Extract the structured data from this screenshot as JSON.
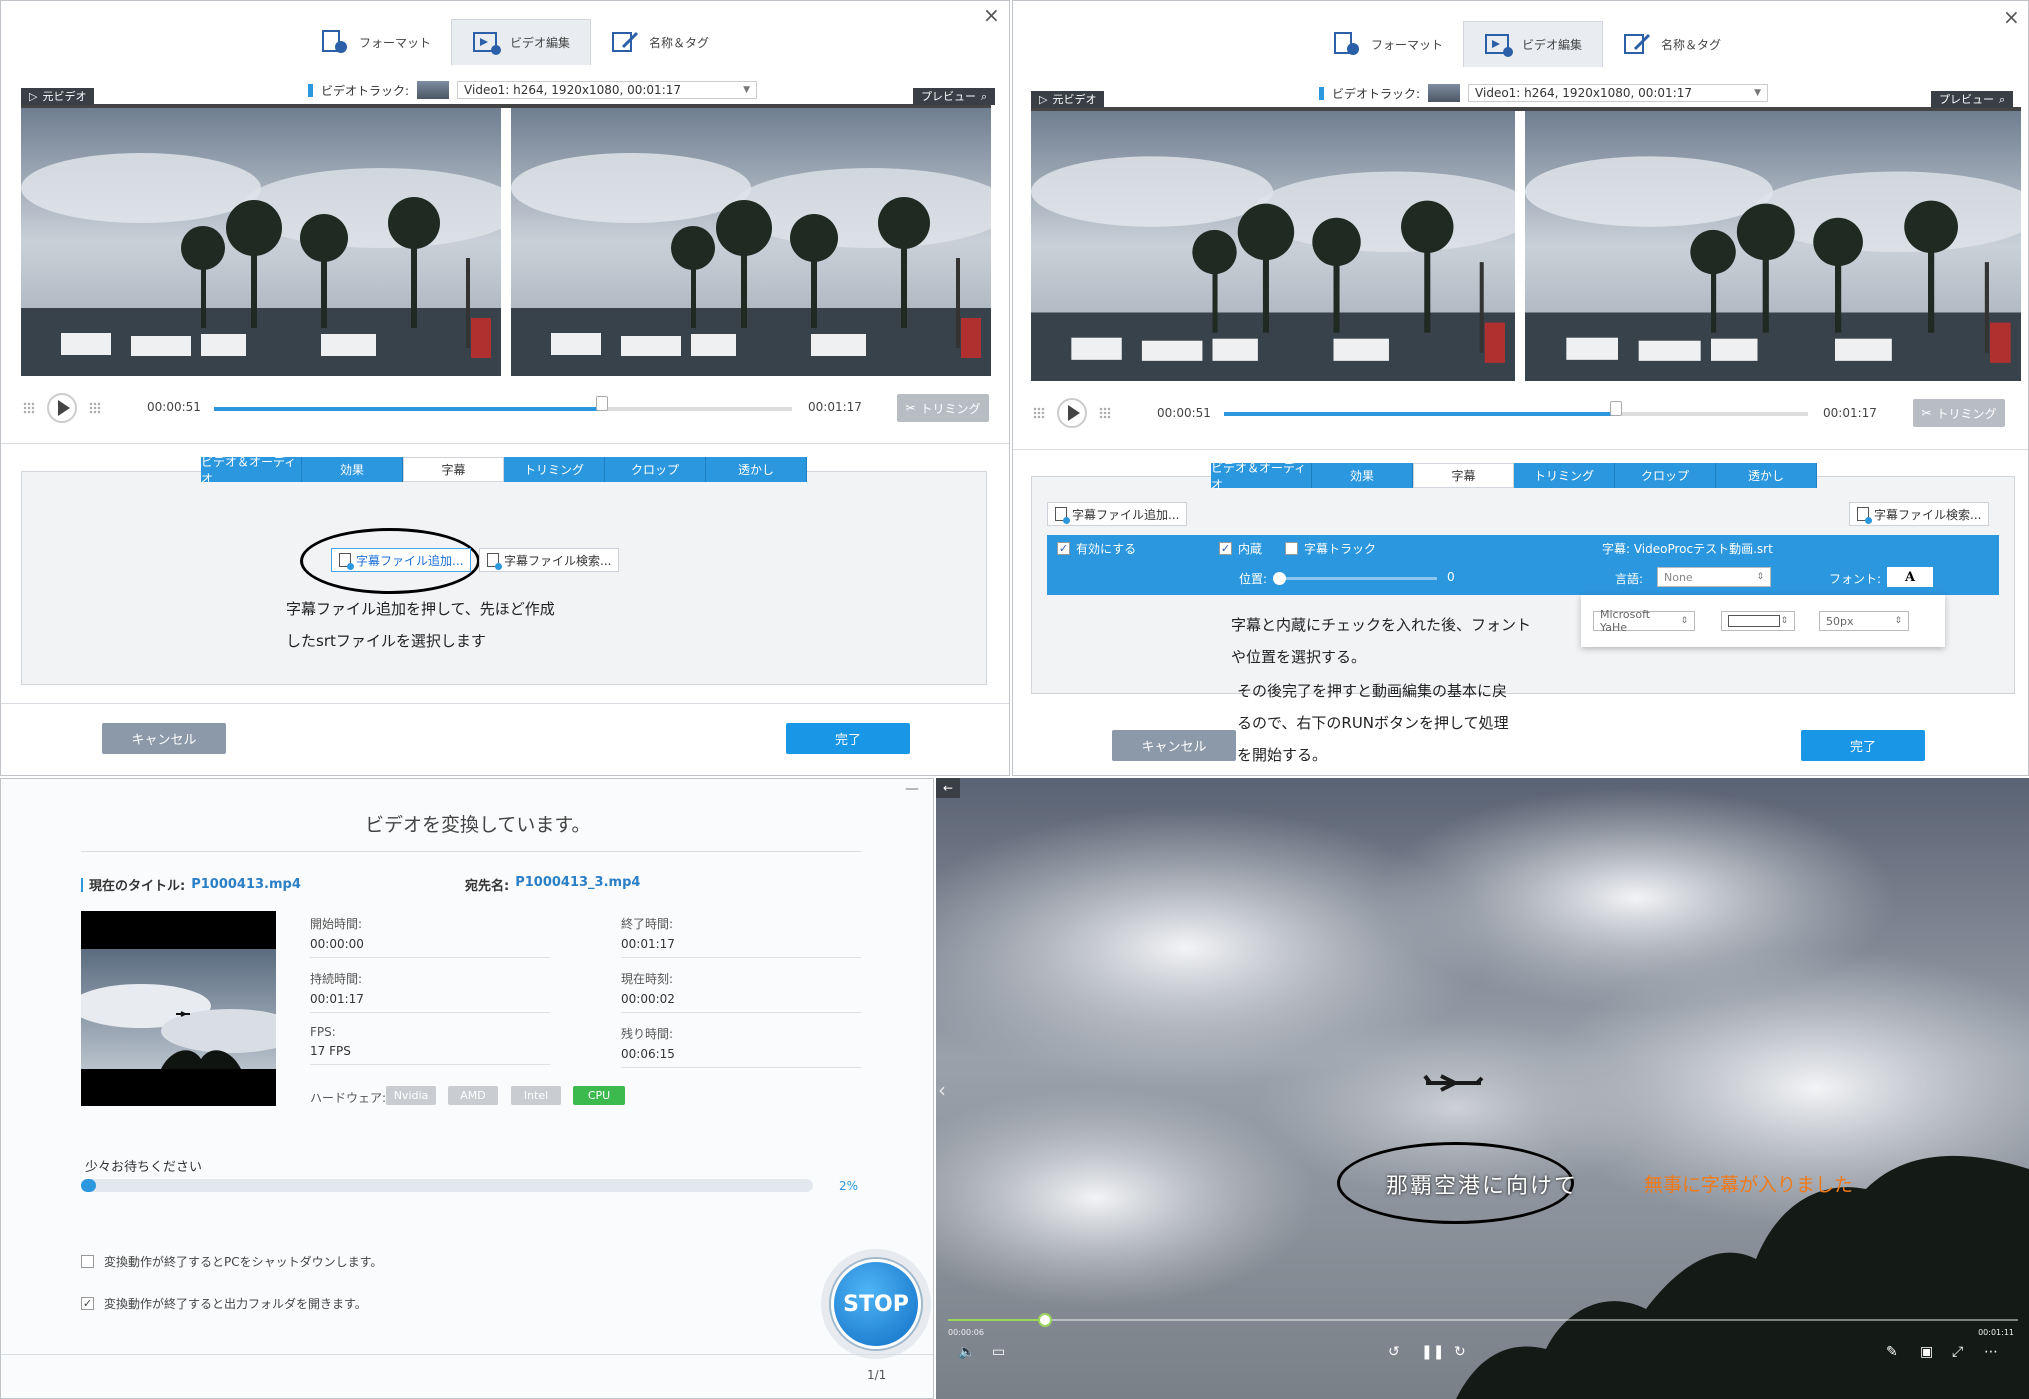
{
  "editor": {
    "tabs": [
      {
        "label": "フォーマット",
        "icon": "format-icon"
      },
      {
        "label": "ビデオ編集",
        "icon": "video-edit-icon"
      },
      {
        "label": "名称＆タグ",
        "icon": "name-tag-icon"
      }
    ],
    "video_track_label": "ビデオトラック:",
    "video_track_value": "Video1: h264, 1920x1080, 00:01:17",
    "source_label": "元ビデオ",
    "preview_label": "プレビュー",
    "current_time": "00:00:51",
    "total_time": "00:01:17",
    "seek_progress": 0.67,
    "trim_button": "トリミング",
    "edit_tabs": [
      "ビデオ＆オーディオ",
      "効果",
      "字幕",
      "トリミング",
      "クロップ",
      "透かし"
    ],
    "active_edit_tab": "字幕",
    "add_subtitle_button": "字幕ファイル追加...",
    "search_subtitle_button": "字幕ファイル検索...",
    "cancel_button": "キャンセル",
    "done_button": "完了"
  },
  "panel1": {
    "annotation_line1": "字幕ファイル追加を押して、先ほど作成",
    "annotation_line2": "したsrtファイルを選択します"
  },
  "panel2": {
    "enable_label": "有効にする",
    "embed_label": "内蔵",
    "subtitle_track_label": "字幕トラック",
    "subtitle_file": "字幕: VideoProcテスト動画.srt",
    "position_label": "位置:",
    "position_value": "0",
    "language_label": "言語:",
    "language_value": "None",
    "font_label": "フォント:",
    "font_button": "A",
    "font_family": "Microsoft YaHe",
    "font_size": "50px",
    "annotation_lines": [
      "字幕と内蔵にチェックを入れた後、フォント",
      "や位置を選択する。",
      "その後完了を押すと動画編集の基本に戻",
      "るので、右下のRUNボタンを押して処理",
      "を開始する。"
    ]
  },
  "converter": {
    "title": "ビデオを変換しています。",
    "current_title_label": "現在のタイトル:",
    "current_title_value": "P1000413.mp4",
    "destination_label": "宛先名:",
    "destination_value": "P1000413_3.mp4",
    "start_time_label": "開始時間:",
    "start_time_value": "00:00:00",
    "end_time_label": "終了時間:",
    "end_time_value": "00:01:17",
    "duration_label": "持続時間:",
    "duration_value": "00:01:17",
    "current_time_label": "現在時刻:",
    "current_time_value": "00:00:02",
    "fps_label": "FPS:",
    "fps_value": "17 FPS",
    "remaining_label": "残り時間:",
    "remaining_value": "00:06:15",
    "hardware_label": "ハードウェア:",
    "hardware": [
      "Nvidia",
      "AMD",
      "Intel",
      "CPU"
    ],
    "active_hardware": "CPU",
    "wait_text": "少々お待ちください",
    "progress_text": "2%",
    "progress": 0.02,
    "shutdown_option": "変換動作が終了するとPCをシャットダウンします。",
    "open_folder_option": "変換動作が終了すると出力フォルダを開きます。",
    "stop_button": "STOP",
    "page_indicator": "1/1",
    "minimize": "—"
  },
  "player": {
    "subtitle_text": "那覇空港に向けて",
    "annotation": "無事に字幕が入りました",
    "start_time": "00:00:06",
    "end_time": "00:01:11",
    "progress": 0.09
  },
  "colors": {
    "accent": "#2b97de",
    "done": "#1a96e6",
    "cancel": "#8c99a9",
    "annotation_orange": "#f07a1a",
    "cpu_green": "#3dba4e"
  }
}
